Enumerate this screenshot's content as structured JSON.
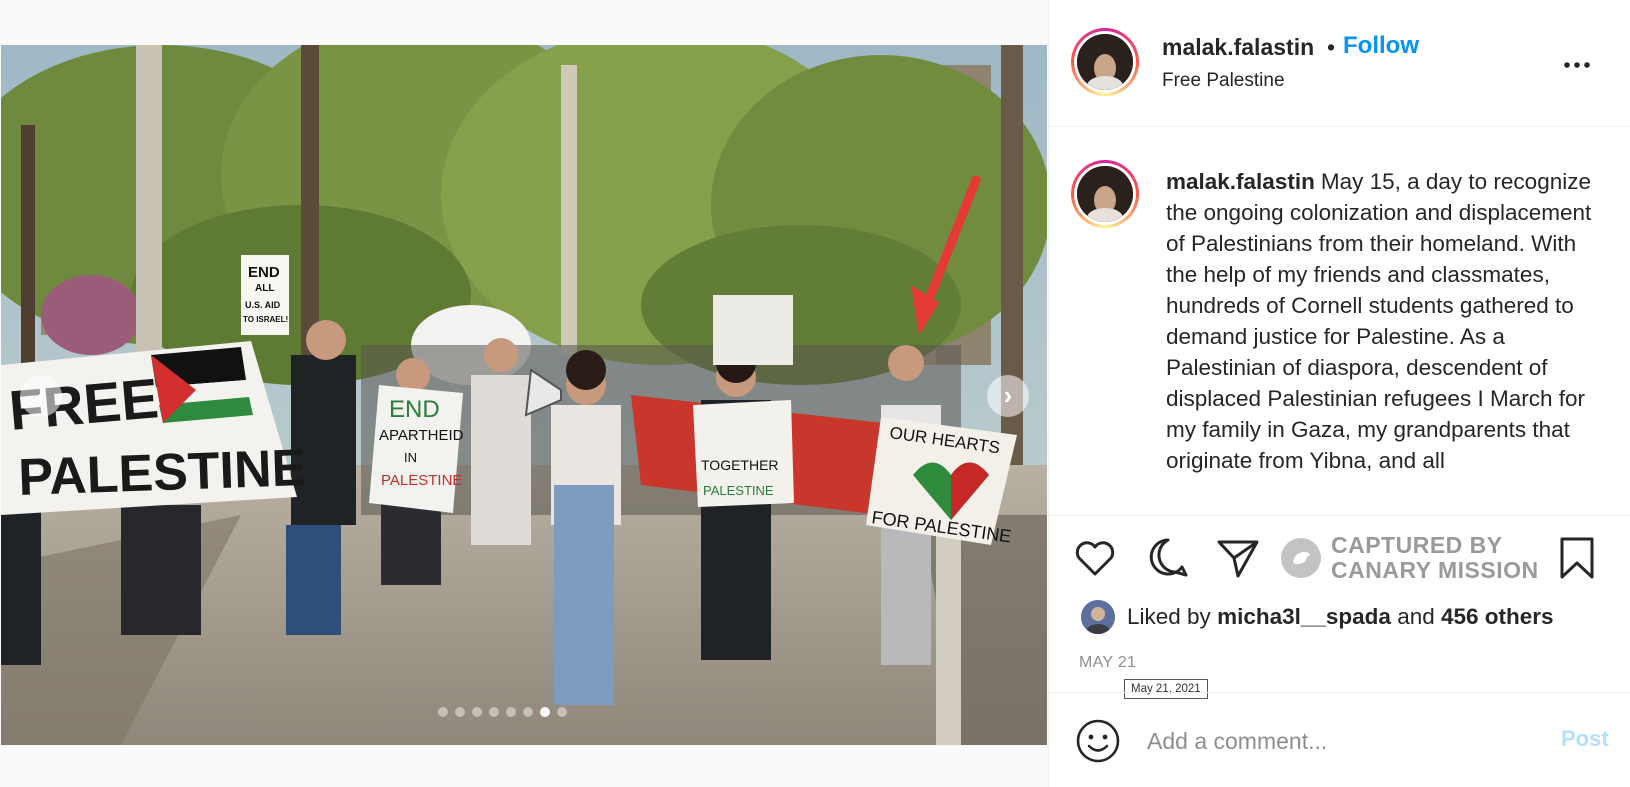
{
  "post": {
    "username": "malak.falastin",
    "separator": "•",
    "follow_label": "Follow",
    "location": "Free Palestine",
    "more_icon": "more-horizontal-icon"
  },
  "caption": {
    "username": "malak.falastin",
    "text": "May 15, a day to recognize the ongoing colonization and displacement of Palestinians from their homeland. With the help of my friends and classmates, hundreds of Cornell students gathered to demand justice for Palestine. As a Palestinian of diaspora, descendent of displaced Palestinian refugees I March for my family in Gaza, my grandparents that originate from Yibna, and all"
  },
  "media": {
    "carousel_count": 8,
    "active_index": 6,
    "signs": {
      "banner_line1": "FREE",
      "banner_line2": "PALESTINE",
      "end_aid_1": "END",
      "end_aid_2": "ALL",
      "end_aid_3": "U.S. AID",
      "end_aid_4": "TO ISRAEL!",
      "apartheid_1": "END",
      "apartheid_2": "APARTHEID",
      "apartheid_3": "IN",
      "apartheid_4": "PALESTINE",
      "together_1": "TOGETHER",
      "together_2": "PALESTINE",
      "hearts_1": "OUR HEARTS",
      "hearts_2": "FOR PALESTINE"
    }
  },
  "actions": {
    "like_icon": "heart-icon",
    "comment_icon": "comment-icon",
    "share_icon": "paper-plane-icon",
    "save_icon": "bookmark-icon",
    "watermark_line1": "CAPTURED BY",
    "watermark_line2": "CANARY MISSION"
  },
  "likes": {
    "prefix": "Liked by",
    "user": "micha3l__spada",
    "middle": "and",
    "others": "456 others"
  },
  "date": {
    "label": "MAY 21",
    "tooltip": "May 21, 2021"
  },
  "comment": {
    "placeholder": "Add a comment...",
    "post_label": "Post"
  },
  "colors": {
    "follow": "#0095f6",
    "post_disabled": "#b2dffc",
    "muted": "#8e8e8e"
  }
}
